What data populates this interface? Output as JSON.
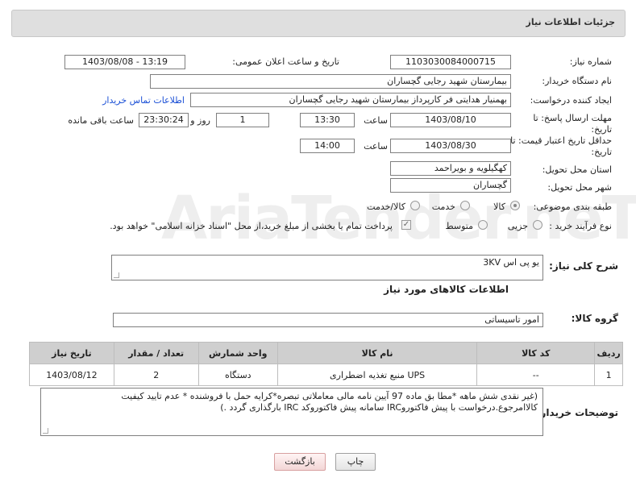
{
  "header": {
    "title": "جزئیات اطلاعات نیاز"
  },
  "fields": {
    "need_number_label": "شماره نیاز:",
    "need_number": "1103030084000715",
    "announce_label": "تاریخ و ساعت اعلان عمومی:",
    "announce_value": "1403/08/08 - 13:19",
    "buyer_org_label": "نام دستگاه خریدار:",
    "buyer_org": "بیمارستان شهید رجایی گچساران",
    "creator_label": "ایجاد کننده درخواست:",
    "creator": "بهمنیار هدایتی فر کارپرداز بیمارستان شهید رجایی گچساران",
    "contact_link": "اطلاعات تماس خریدار",
    "deadline_label_1": "مهلت ارسال پاسخ: تا",
    "deadline_label_2": "تاریخ:",
    "deadline_date": "1403/08/10",
    "time_label": "ساعت",
    "deadline_time": "13:30",
    "days_value": "1",
    "days_label": "روز و",
    "remaining_time": "23:30:24",
    "remaining_label": "ساعت باقی مانده",
    "validity_label_1": "حداقل تاریخ اعتبار قیمت: تا",
    "validity_label_2": "تاریخ:",
    "validity_date": "1403/08/30",
    "validity_time_label": "ساعت",
    "validity_time": "14:00",
    "province_label": "استان محل تحویل:",
    "province": "کهگیلویه و بویراحمد",
    "city_label": "شهر محل تحویل:",
    "city": "گچساران",
    "category_label": "طبقه بندی موضوعی:",
    "category_options": [
      "کالا",
      "خدمت",
      "کالا/خدمت"
    ],
    "process_label": "نوع فرآیند خرید :",
    "process_options": [
      "جزیی",
      "متوسط"
    ],
    "payment_note": "پرداخت تمام یا بخشی از مبلغ خرید،از محل \"اسناد خزانه اسلامی\" خواهد بود."
  },
  "description": {
    "label": "شرح کلی نیاز:",
    "value": "یو پی اس 3KV"
  },
  "goods_section_title": "اطلاعات کالاهای مورد نیاز",
  "goods_group": {
    "label": "گروه کالا:",
    "value": "امور تاسیساتی"
  },
  "table": {
    "headers": [
      "ردیف",
      "کد کالا",
      "نام کالا",
      "واحد شمارش",
      "تعداد / مقدار",
      "تاریخ نیاز"
    ],
    "rows": [
      [
        "1",
        "--",
        "منبع تغذیه اضطراری UPS",
        "دستگاه",
        "2",
        "1403/08/12"
      ]
    ]
  },
  "buyer_notes": {
    "label": "توضیحات خریدار:",
    "value": "(غیر نقدی شش ماهه  *مطا بق ماده 97 آیین نامه مالی معاملاتی تبصره*کرایه حمل با فروشنده * عدم تایید کیفیت کالاامرجوع.درخواست با پیش فاکتوروIRC سامانه  پیش فاکتوروکد IRC بارگذاری گردد .)"
  },
  "buttons": {
    "print": "چاپ",
    "back": "بازگشت"
  },
  "watermark": "AriaTender.neT"
}
